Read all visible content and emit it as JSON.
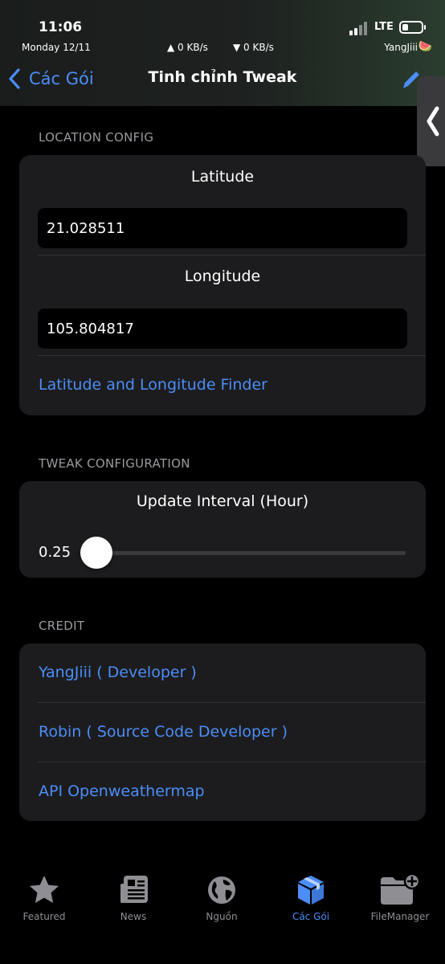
{
  "status": {
    "time": "11:06",
    "date": "Monday 12/11",
    "upload": "▲ 0 KB/s",
    "download": "▼ 0 KB/s",
    "user": "YangJiii",
    "network": "LTE"
  },
  "nav": {
    "back_label": "Các Gói",
    "title": "Tinh chỉnh Tweak"
  },
  "location": {
    "section": "LOCATION CONFIG",
    "latitude_label": "Latitude",
    "latitude_value": "21.028511",
    "longitude_label": "Longitude",
    "longitude_value": "105.804817",
    "finder_link": "Latitude and Longitude Finder"
  },
  "tweak": {
    "section": "TWEAK CONFIGURATION",
    "interval_label": "Update Interval (Hour)",
    "interval_value": "0.25",
    "slider_fraction": 0.0
  },
  "credit": {
    "section": "CREDIT",
    "items": [
      "YangJiii ( Developer )",
      "Robin ( Source Code Developer )",
      "API Openweathermap"
    ]
  },
  "tabs": [
    {
      "label": "Featured",
      "icon": "star-icon"
    },
    {
      "label": "News",
      "icon": "newspaper-icon"
    },
    {
      "label": "Nguồn",
      "icon": "globe-icon"
    },
    {
      "label": "Các Gói",
      "icon": "package-icon",
      "active": true
    },
    {
      "label": "FileManager",
      "icon": "folder-add-icon"
    }
  ],
  "colors": {
    "accent": "#4c8df6",
    "card": "#1c1c1e",
    "background": "#000000"
  }
}
